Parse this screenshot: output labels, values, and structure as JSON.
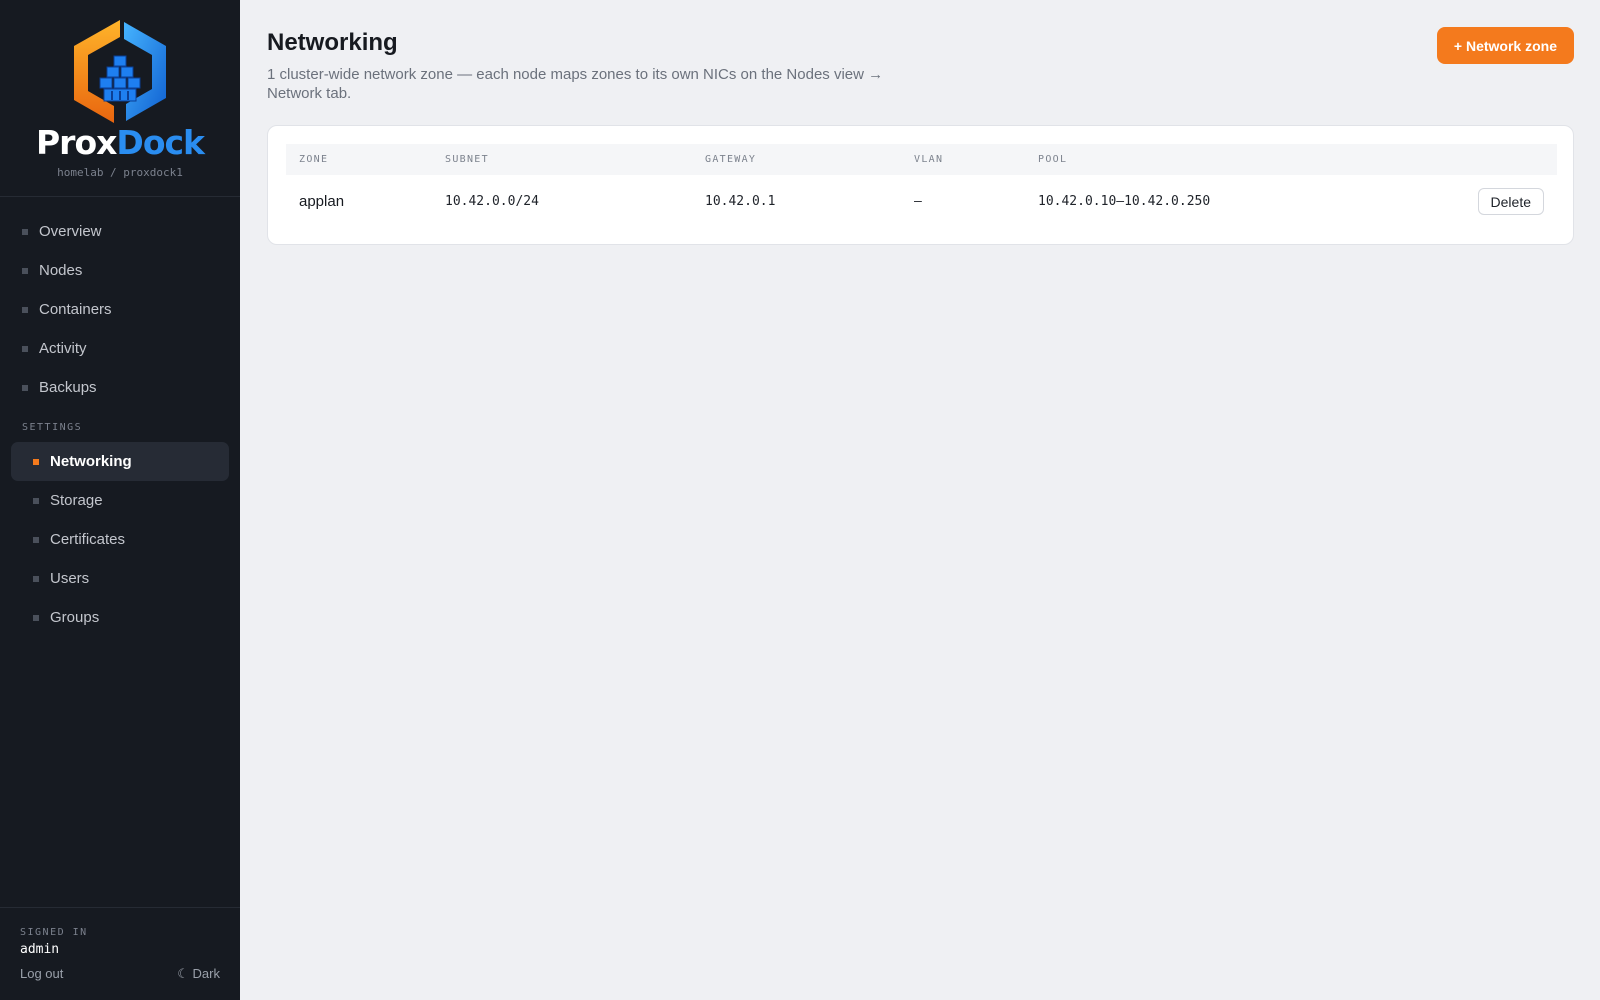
{
  "brand": {
    "name_part1": "Prox",
    "name_part2": "Dock",
    "breadcrumb": "homelab / proxdock1"
  },
  "sidebar": {
    "items": [
      {
        "label": "Overview"
      },
      {
        "label": "Nodes"
      },
      {
        "label": "Containers"
      },
      {
        "label": "Activity"
      },
      {
        "label": "Backups"
      }
    ],
    "settings_label": "SETTINGS",
    "settings_items": [
      {
        "label": "Networking",
        "active": true
      },
      {
        "label": "Storage"
      },
      {
        "label": "Certificates"
      },
      {
        "label": "Users"
      },
      {
        "label": "Groups"
      }
    ],
    "footer": {
      "signed_in_label": "SIGNED IN",
      "username": "admin",
      "logout_label": "Log out",
      "theme_label": "☾ Dark"
    }
  },
  "main": {
    "title": "Networking",
    "subtitle": "1 cluster-wide network zone — each node maps zones to its own NICs on the Nodes view → Network tab.",
    "add_button": "+ Network zone",
    "table": {
      "headers": [
        "ZONE",
        "SUBNET",
        "GATEWAY",
        "VLAN",
        "POOL"
      ],
      "rows": [
        {
          "zone": "applan",
          "subnet": "10.42.0.0/24",
          "gateway": "10.42.0.1",
          "vlan": "—",
          "pool": "10.42.0.10–10.42.0.250",
          "action": "Delete"
        }
      ]
    }
  },
  "colors": {
    "accent": "#f47a1d",
    "sidebar_bg": "#161a21",
    "brand_blue": "#2a8df0",
    "page_bg": "#eff0f3"
  },
  "icons": {
    "logo": "proxdock-hexagon-cubes-logo",
    "nav_bullet": "square-bullet-icon",
    "theme": "moon-icon"
  }
}
